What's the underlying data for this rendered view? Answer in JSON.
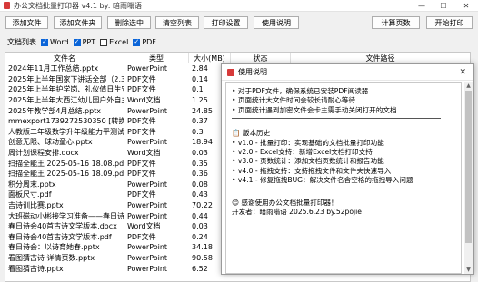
{
  "window": {
    "title": "办公文档批量打印器 v4.1 by: 暗雨嗡语",
    "minimize": "—",
    "maximize": "☐",
    "close": "✕"
  },
  "toolbar": {
    "add_files": "添加文件",
    "add_folder": "添加文件夹",
    "delete_selected": "删除选中",
    "clear_list": "清空列表",
    "print_settings": "打印设置",
    "usage": "使用说明",
    "count_pages": "计算页数",
    "start_print": "开始打印"
  },
  "filter": {
    "label": "文档列表",
    "options": [
      {
        "name": "Word",
        "checked": true
      },
      {
        "name": "PPT",
        "checked": true
      },
      {
        "name": "Excel",
        "checked": false
      },
      {
        "name": "PDF",
        "checked": true
      }
    ]
  },
  "table": {
    "columns": [
      "文件名",
      "类型",
      "大小(MB)",
      "状态",
      "文件路径"
    ],
    "rows": [
      [
        "2024年11月工作总结.pptx",
        "PowerPoint",
        "2.84",
        "",
        ""
      ],
      [
        "2025年上半年国家下讲话全部（2.3）.p",
        "PDF文件",
        "0.14",
        "",
        ""
      ],
      [
        "2025年上半年护学岗、礼仪值日生安排",
        "PDF文件",
        "0.1",
        "",
        ""
      ],
      [
        "2025年上半年大西江幼儿园户外自主游戏",
        "Word文档",
        "1.25",
        "",
        ""
      ],
      [
        "2025年教学部4月总结.pptx",
        "PowerPoint",
        "24.85",
        "",
        ""
      ],
      [
        "mmexport1739272530350 [转换].pdf",
        "PDF文件",
        "0.37",
        "",
        ""
      ],
      [
        "人教版二年级数学升年级能力平测试.pd",
        "PDF文件",
        "0.3",
        "",
        ""
      ],
      [
        "创意无限、球动童心.pptx",
        "PowerPoint",
        "18.94",
        "",
        ""
      ],
      [
        "周计划课程安排.docx",
        "Word文档",
        "0.03",
        "",
        ""
      ],
      [
        "扫描全能王 2025-05-16 18.08.pdf",
        "PDF文件",
        "0.35",
        "",
        ""
      ],
      [
        "扫描全能王 2025-05-16 18.09.pdf",
        "PDF文件",
        "0.36",
        "",
        ""
      ],
      [
        "积分周末.pptx",
        "PowerPoint",
        "0.08",
        "",
        ""
      ],
      [
        "面板尺寸.pdf",
        "PDF文件",
        "0.43",
        "",
        ""
      ],
      [
        "吉诗训比赛.pptx",
        "PowerPoint",
        "70.22",
        "",
        ""
      ],
      [
        "大班磁动小彬接学习准备——春日诗会]",
        "PowerPoint",
        "0.44",
        "",
        ""
      ],
      [
        "春日诗会40首古诗文学版本.docx",
        "Word文档",
        "0.03",
        "",
        ""
      ],
      [
        "春日诗会40首古诗文学版本.pdf",
        "PDF文件",
        "0.24",
        "",
        ""
      ],
      [
        "春日诗会：以诗育她春.pptx",
        "PowerPoint",
        "34.18",
        "",
        ""
      ],
      [
        "看图猜古诗 详情页数.pptx",
        "PowerPoint",
        "90.58",
        "",
        ""
      ],
      [
        "看图猜古诗.pptx",
        "PowerPoint",
        "6.52",
        "",
        ""
      ]
    ]
  },
  "dialog": {
    "title": "使用说明",
    "close": "✕",
    "bullets": [
      "• 对于PDF文件，确保系统已安装PDF阅读器",
      "• 页面统计大文件时间会较长请耐心等待",
      "• 页面统计遇到加密文件会卡主需手动关闭打开的文档"
    ],
    "history_title": "📋 版本历史",
    "history": [
      "• v1.0 - 批量打印：实现基础的文档批量打印功能",
      "• v2.0 - Excel支持：新增Excel文档打印支持",
      "• v3.0 - 页数统计：添加文档页数统计和报告功能",
      "• v4.0 - 拖拽支持：支持拖拽文件和文件夹快速导入",
      "• v4.1 - 修复拖拽BUG：解决文件名含空格的拖拽导入问题"
    ],
    "thanks": "😊 感谢使用办公文档批量打印器！",
    "developer": "开发者：暗雨嗡语 2025.6.23 by.52pojie"
  }
}
